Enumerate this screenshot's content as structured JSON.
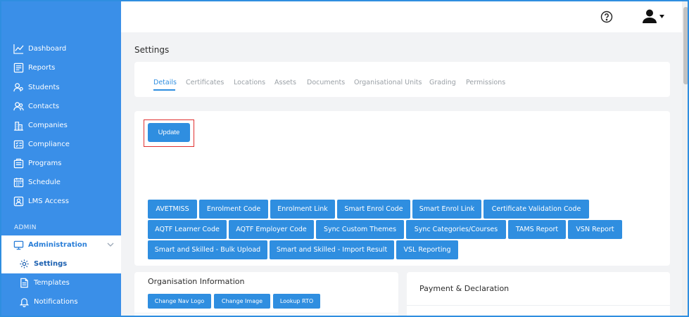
{
  "sidebar": {
    "items": [
      {
        "label": "Dashboard",
        "icon": "chart-line-icon"
      },
      {
        "label": "Reports",
        "icon": "report-icon"
      },
      {
        "label": "Students",
        "icon": "students-icon"
      },
      {
        "label": "Contacts",
        "icon": "contacts-icon"
      },
      {
        "label": "Companies",
        "icon": "building-icon"
      },
      {
        "label": "Compliance",
        "icon": "compliance-icon"
      },
      {
        "label": "Programs",
        "icon": "programs-icon"
      },
      {
        "label": "Schedule",
        "icon": "calendar-icon"
      },
      {
        "label": "LMS Access",
        "icon": "lms-icon"
      }
    ],
    "admin_heading": "ADMIN",
    "admin_items": [
      {
        "label": "Administration",
        "icon": "monitor-icon"
      },
      {
        "label": "Settings",
        "icon": "gear-icon"
      },
      {
        "label": "Templates",
        "icon": "template-icon"
      },
      {
        "label": "Notifications",
        "icon": "bell-icon"
      }
    ]
  },
  "page": {
    "title": "Settings",
    "tabs": [
      "Details",
      "Certificates",
      "Locations",
      "Assets",
      "Documents",
      "Organisational Units",
      "Grading",
      "Permissions"
    ],
    "active_tab": "Details",
    "update_label": "Update",
    "buttons": [
      "AVETMISS",
      "Enrolment Code",
      "Enrolment Link",
      "Smart Enrol Code",
      "Smart Enrol Link",
      "Certificate Validation Code",
      "AQTF Learner Code",
      "AQTF Employer Code",
      "Sync Custom Themes",
      "Sync Categories/Courses",
      "TAMS Report",
      "VSN Report",
      "Smart and Skilled - Bulk Upload",
      "Smart and Skilled - Import Result",
      "VSL Reporting"
    ],
    "org": {
      "title": "Organisation Information",
      "buttons": [
        "Change Nav Logo",
        "Change Image",
        "Lookup RTO"
      ]
    },
    "payment": {
      "title": "Payment & Declaration"
    }
  },
  "colors": {
    "primary": "#2f8ee0",
    "sidebar": "#3a8fe8",
    "highlight": "#e03030"
  }
}
